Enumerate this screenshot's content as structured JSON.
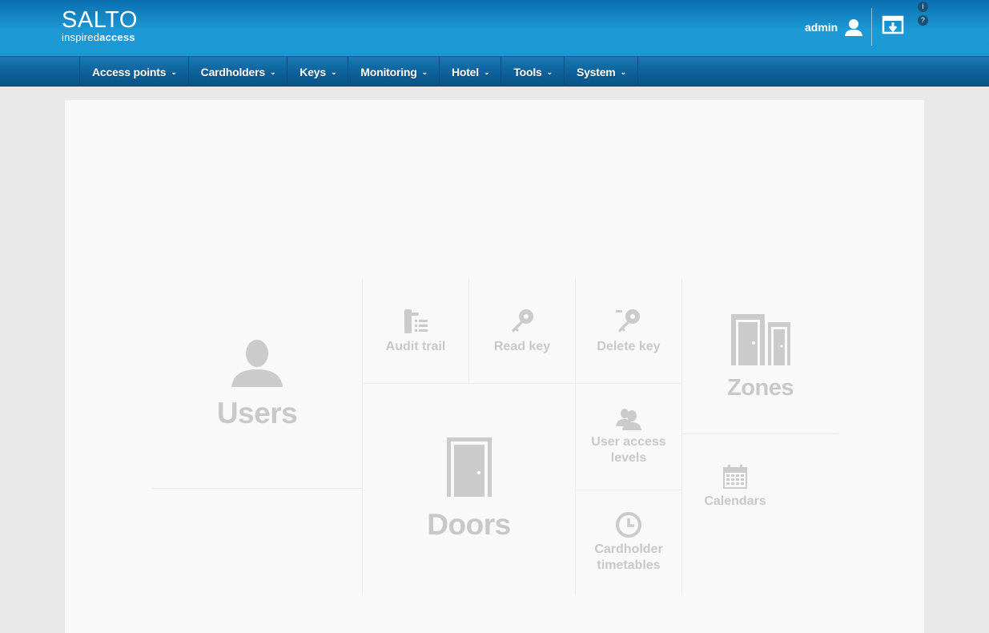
{
  "brand": {
    "name": "SALTO",
    "tagline_light": "inspired",
    "tagline_bold": "access"
  },
  "user": {
    "name": "admin"
  },
  "header_icons": [
    "user-icon",
    "logout-icon",
    "info-icon",
    "help-icon"
  ],
  "mini": {
    "info": "i",
    "help": "?"
  },
  "nav": [
    {
      "label": "Access points",
      "caret": "⌄"
    },
    {
      "label": "Cardholders",
      "caret": "⌄"
    },
    {
      "label": "Keys",
      "caret": "⌄"
    },
    {
      "label": "Monitoring",
      "caret": "⌄"
    },
    {
      "label": "Hotel",
      "caret": "⌄"
    },
    {
      "label": "Tools",
      "caret": "⌄"
    },
    {
      "label": "System",
      "caret": "⌄"
    }
  ],
  "tiles": {
    "users": "Users",
    "audit_trail": "Audit trail",
    "read_key": "Read key",
    "delete_key": "Delete key",
    "zones": "Zones",
    "doors": "Doors",
    "user_access_levels_1": "User access",
    "user_access_levels_2": "levels",
    "calendars": "Calendars",
    "cardholder_timetables_1": "Cardholder",
    "cardholder_timetables_2": "timetables"
  },
  "colors": {
    "header_blue": "#1d9ad6",
    "nav_blue": "#0d5f97",
    "tile_gray": "#c8c8c8",
    "panel_bg": "#f9f9f9"
  }
}
